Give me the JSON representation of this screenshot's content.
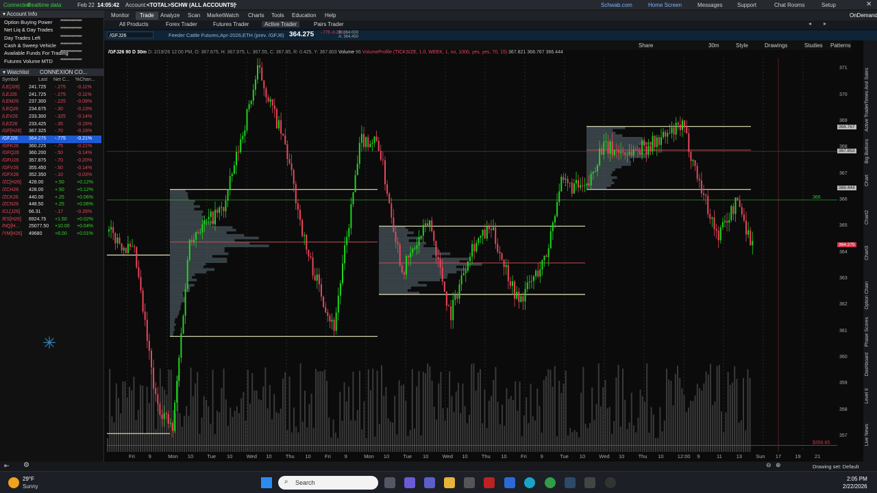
{
  "topbar": {
    "status": "Connected",
    "data_mode": "Realtime data",
    "date": "Feb 22",
    "time": "14:05:42",
    "account_label": "Account:",
    "account_value": "<TOTAL>SCHW (ALL ACCOUNTS)",
    "links": [
      "Schwab.com",
      "Home Screen",
      "Messages",
      "Support",
      "Chat Rooms",
      "Setup"
    ]
  },
  "nav": {
    "tabs": [
      "Monitor",
      "Trade",
      "Analyze",
      "Scan",
      "MarketWatch",
      "Charts",
      "Tools",
      "Education",
      "Help"
    ],
    "active": "Trade",
    "ondemand": "OnDemand"
  },
  "subnav": {
    "tabs": [
      "All Products",
      "Forex Trader",
      "Futures Trader",
      "Active Trader",
      "Pairs Trader"
    ],
    "active": "Active Trader"
  },
  "symbolbar": {
    "symbol": "/GFJ26",
    "description": "Feeder Cattle Futures,Apr-2026,ETH (prev. /GFJ6)",
    "price": "364.275",
    "change": "-.775",
    "change_pct": "-0.21%",
    "bid": "B: 364.000",
    "ask": "A: 364.450"
  },
  "chart_toolbar": {
    "items": [
      "Share",
      "30m",
      "Style",
      "Drawings",
      "Studies",
      "Patterns"
    ]
  },
  "chart_header": {
    "symbol_period": "/GFJ26 90 D 30m",
    "ohlc": "D: 2/19/26 12:00 PM, O: 367.675, H: 367.975, L: 367.55, C: 367.85, R: 0.425, Y: 367.803",
    "volume": "Volume",
    "volume_value": "96",
    "vp_label": "VolumeProfile (TICKSIZE, 1.0, WEEK, 1, no, 1000, yes, yes, 70, 15)",
    "vp_val1": "367.821",
    "vp_val2": "368.767",
    "vp_val3": "366.444"
  },
  "account_info": {
    "title": "Account Info",
    "rows": [
      "Option Buying Power",
      "Net Liq & Day Trades",
      "Day Trades Left",
      "Cash & Sweep Vehicle",
      "Available Funds For Trading",
      "Futures Volume MTD"
    ],
    "masked": "**************"
  },
  "watchlist": {
    "title": "Watchlist",
    "name": "CONNEXION CO...",
    "headers": [
      "Symbol",
      "Last",
      "Net C...",
      "%Chan..."
    ],
    "rows": [
      {
        "sym": "/LE[J26]",
        "last": "241.725",
        "net": "-.275",
        "pct": "-0.11%",
        "up": false
      },
      {
        "sym": "/LEJ26",
        "last": "241.725",
        "net": "-.275",
        "pct": "-0.11%",
        "up": false
      },
      {
        "sym": "/LEM26",
        "last": "237.300",
        "net": "-.225",
        "pct": "-0.09%",
        "up": false
      },
      {
        "sym": "/LEQ26",
        "last": "234.675",
        "net": "-.30",
        "pct": "-0.13%",
        "up": false
      },
      {
        "sym": "/LEV26",
        "last": "233.300",
        "net": "-.325",
        "pct": "-0.14%",
        "up": false
      },
      {
        "sym": "/LEZ26",
        "last": "233.425",
        "net": "-.35",
        "pct": "-0.15%",
        "up": false
      },
      {
        "sym": "/GF[H26]",
        "last": "367.325",
        "net": "-.70",
        "pct": "-0.19%",
        "up": false
      },
      {
        "sym": "/GFJ26",
        "last": "364.275",
        "net": "-.775",
        "pct": "-0.21%",
        "up": false,
        "selected": true
      },
      {
        "sym": "/GFK26",
        "last": "360.225",
        "net": "-.75",
        "pct": "-0.21%",
        "up": false
      },
      {
        "sym": "/GFQ26",
        "last": "360.200",
        "net": "-.50",
        "pct": "-0.14%",
        "up": false
      },
      {
        "sym": "/GFU26",
        "last": "357.875",
        "net": "-.70",
        "pct": "-0.20%",
        "up": false
      },
      {
        "sym": "/GFV26",
        "last": "355.450",
        "net": "-.50",
        "pct": "-0.14%",
        "up": false
      },
      {
        "sym": "/GFX26",
        "last": "352.350",
        "net": "-.10",
        "pct": "-0.03%",
        "up": false
      },
      {
        "sym": "/ZC[H26]",
        "last": "428.00",
        "net": "+.50",
        "pct": "+0.12%",
        "up": true
      },
      {
        "sym": "/ZCH26",
        "last": "428.00",
        "net": "+.50",
        "pct": "+0.12%",
        "up": true
      },
      {
        "sym": "/ZCK26",
        "last": "440.00",
        "net": "+.25",
        "pct": "+0.06%",
        "up": true
      },
      {
        "sym": "/ZCN26",
        "last": "448.50",
        "net": "+.25",
        "pct": "+0.06%",
        "up": true
      },
      {
        "sym": "/CL[J26]",
        "last": "66.31",
        "net": "-.17",
        "pct": "-0.26%",
        "up": false
      },
      {
        "sym": "/ES[H26]",
        "last": "6924.75",
        "net": "+1.50",
        "pct": "+0.02%",
        "up": true
      },
      {
        "sym": "/NQ[H...",
        "last": "25077.50",
        "net": "+10.00",
        "pct": "+0.04%",
        "up": true
      },
      {
        "sym": "/YM[H26]",
        "last": "49680",
        "net": "+6.00",
        "pct": "+0.01%",
        "up": true
      }
    ]
  },
  "price_axis": {
    "ticks": [
      "371",
      "370",
      "369",
      "368",
      "367",
      "366",
      "365",
      "364",
      "363",
      "362",
      "361",
      "360",
      "359",
      "358",
      "357"
    ],
    "badges": [
      {
        "label": "368.767",
        "price": 368.767,
        "color": "#bdbdbd"
      },
      {
        "label": "367.853",
        "price": 367.853,
        "color": "#bdbdbd"
      },
      {
        "label": "366.444",
        "price": 366.444,
        "color": "#bdbdbd"
      },
      {
        "label": "364.275",
        "price": 364.275,
        "color": "#d6344b"
      }
    ],
    "line_labels": [
      {
        "label": "366",
        "price": 366.0,
        "color": "#36c236"
      },
      {
        "label": "$356.65",
        "price": 356.65,
        "color": "#d6344b"
      }
    ]
  },
  "time_axis": {
    "labels": [
      "Fri",
      "9",
      "Mon",
      "10",
      "Tue",
      "10",
      "Wed",
      "10",
      "Thu",
      "10",
      "Fri",
      "9",
      "Mon",
      "10",
      "Tue",
      "10",
      "Wed",
      "10",
      "Thu",
      "10",
      "Fri",
      "9",
      "Tue",
      "10",
      "Wed",
      "10",
      "Thu",
      "10",
      "12:00",
      "9",
      "11",
      "13",
      "Sun",
      "17",
      "19",
      "21"
    ]
  },
  "right_tabs": [
    "Times And Sales",
    "Active Trader",
    "Big Buttons",
    "Chart",
    "Chart2",
    "Chart3",
    "Option Chain",
    "Phase Scores",
    "Dashboard",
    "Level II",
    "Live News"
  ],
  "bottom_bar": {
    "drawing_set": "Drawing set: Default"
  },
  "taskbar": {
    "weather_temp": "29°F",
    "weather_desc": "Sunny",
    "search_placeholder": "Search",
    "clock_time": "2:05 PM",
    "clock_date": "2/22/2026"
  },
  "colors": {
    "up": "#1fd61f",
    "down": "#e8475a",
    "profile": "#5d6f78",
    "range_line": "#e9e6c0",
    "selected_row": "#1e5ad4"
  }
}
